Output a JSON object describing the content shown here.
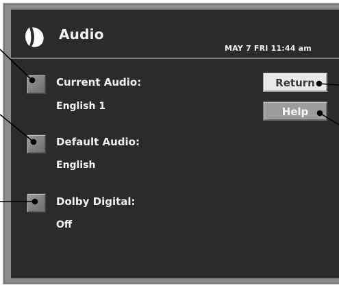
{
  "header": {
    "title": "Audio",
    "datetime": "MAY  7 FRI  11:44 am"
  },
  "settings": [
    {
      "label": "Current Audio:",
      "value": "English 1"
    },
    {
      "label": "Default Audio:",
      "value": "English"
    },
    {
      "label": "Dolby Digital:",
      "value": "Off"
    }
  ],
  "buttons": {
    "return_label": "Return",
    "help_label": "Help"
  },
  "colors": {
    "background": "#2b2b2b",
    "frame": "#8c8c8c",
    "text": "#f2f2f2",
    "return_button": "#e8e8e8",
    "help_button": "#9c9c9c"
  },
  "icons": [
    "audio-logo-icon"
  ]
}
